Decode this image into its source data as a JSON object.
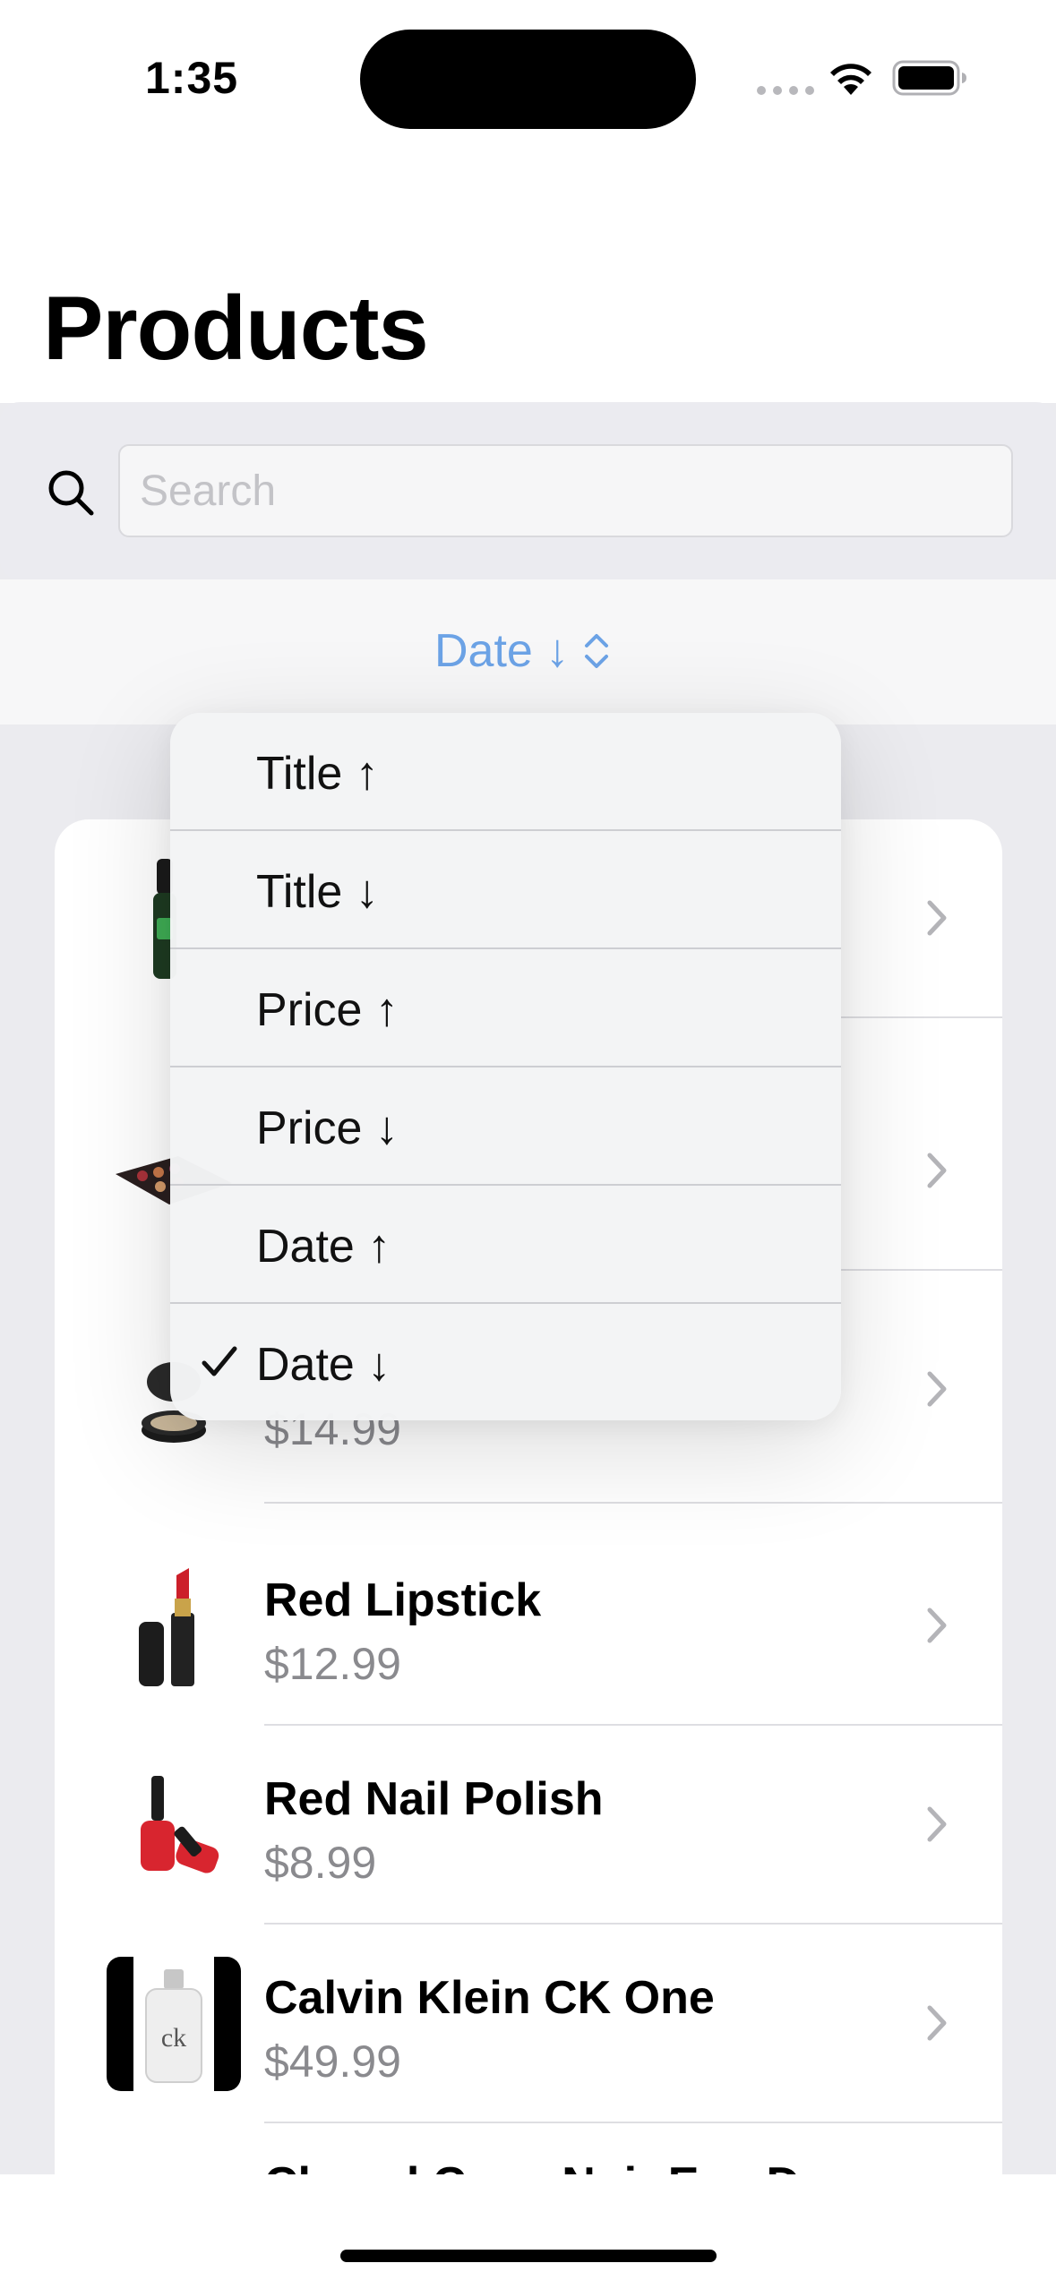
{
  "status_bar": {
    "time": "1:35"
  },
  "page": {
    "title": "Products"
  },
  "search": {
    "placeholder": "Search"
  },
  "sort": {
    "label": "Date ↓"
  },
  "menu": {
    "items": [
      {
        "label": "Title ↑",
        "checked": false
      },
      {
        "label": "Title ↓",
        "checked": false
      },
      {
        "label": "Price ↑",
        "checked": false
      },
      {
        "label": "Price ↓",
        "checked": false
      },
      {
        "label": "Date ↑",
        "checked": false
      },
      {
        "label": "Date ↓",
        "checked": true
      }
    ]
  },
  "products": [
    {
      "name": "",
      "price": "",
      "icon": "mascara-icon"
    },
    {
      "name": "",
      "price": "",
      "icon": "eyeshadow-palette-icon"
    },
    {
      "name": "",
      "price": "$14.99",
      "icon": "powder-compact-icon"
    },
    {
      "name": "Red Lipstick",
      "price": "$12.99",
      "icon": "lipstick-icon"
    },
    {
      "name": "Red Nail Polish",
      "price": "$8.99",
      "icon": "nail-polish-icon"
    },
    {
      "name": "Calvin Klein CK One",
      "price": "$49.99",
      "icon": "perfume-bottle-icon"
    },
    {
      "name": "Chanel Coco Noir Eau De",
      "price": "",
      "icon": "perfume-icon"
    }
  ],
  "colors": {
    "accent": "#6ca3e6",
    "secondary_text": "#8a8a8e",
    "background": "#ebebef"
  }
}
